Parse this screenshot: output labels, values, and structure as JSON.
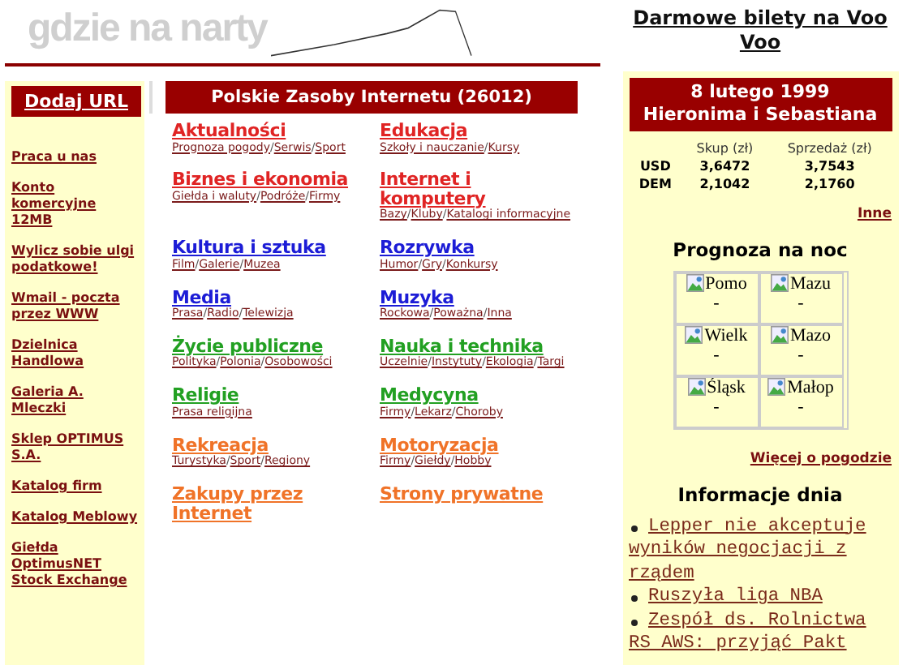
{
  "header": {
    "logo": "gdzie na narty",
    "promo_link": "Darmowe bilety na Voo Voo"
  },
  "sidebar": {
    "button": "Dodaj URL",
    "links": [
      "Praca u nas",
      "Konto komercyjne 12MB",
      "Wylicz sobie ulgi podatkowe!",
      "Wmail - poczta przez WWW",
      "Dzielnica Handlowa",
      "Galeria A. Mleczki",
      "Sklep OPTIMUS S.A.",
      "Katalog firm",
      "Katalog Meblowy",
      "Giełda OptimusNET Stock Exchange"
    ]
  },
  "directory": {
    "title": "Polskie Zasoby Internetu (26012)",
    "categories": [
      {
        "name": "Aktualności",
        "color": "#e02424",
        "links": [
          "Prognoza pogody",
          "Serwis",
          "Sport"
        ]
      },
      {
        "name": "Edukacja",
        "color": "#e02424",
        "links": [
          "Szkoły i nauczanie",
          "Kursy"
        ]
      },
      {
        "name": "Biznes i ekonomia",
        "color": "#e02424",
        "links": [
          "Giełda i waluty",
          "Podróże",
          "Firmy"
        ]
      },
      {
        "name": "Internet i komputery",
        "color": "#e02424",
        "links": [
          "Bazy",
          "Kluby",
          "Katalogi informacyjne"
        ]
      },
      {
        "name": "Kultura i sztuka",
        "color": "#1c1cd6",
        "links": [
          "Film",
          "Galerie",
          "Muzea"
        ]
      },
      {
        "name": "Rozrywka",
        "color": "#1c1cd6",
        "links": [
          "Humor",
          "Gry",
          "Konkursy"
        ]
      },
      {
        "name": "Media",
        "color": "#1c1cd6",
        "links": [
          "Prasa",
          "Radio",
          "Telewizja"
        ]
      },
      {
        "name": "Muzyka",
        "color": "#1c1cd6",
        "links": [
          "Rockowa",
          "Poważna",
          "Inna"
        ]
      },
      {
        "name": "Życie publiczne",
        "color": "#22a022",
        "links": [
          "Polityka",
          "Polonia",
          "Osobowości"
        ]
      },
      {
        "name": "Nauka i technika",
        "color": "#22a022",
        "links": [
          "Uczelnie",
          "Instytuty",
          "Ekologia",
          "Targi"
        ]
      },
      {
        "name": "Religie",
        "color": "#22a022",
        "links": [
          "Prasa religijna"
        ]
      },
      {
        "name": "Medycyna",
        "color": "#22a022",
        "links": [
          "Firmy",
          "Lekarz",
          "Choroby"
        ]
      },
      {
        "name": "Rekreacja",
        "color": "#f07328",
        "links": [
          "Turystyka",
          "Sport",
          "Regiony"
        ]
      },
      {
        "name": "Motoryzacja",
        "color": "#f07328",
        "links": [
          "Firmy",
          "Giełdy",
          "Hobby"
        ]
      },
      {
        "name": "Zakupy przez Internet",
        "color": "#f07328"
      },
      {
        "name": "Strony prywatne",
        "color": "#f07328"
      }
    ],
    "separator": "/"
  },
  "info_panel": {
    "date": "8 lutego 1999",
    "name_day": "Hieronima i Sebastiana",
    "rates": {
      "columns": [
        "Skup (zł)",
        "Sprzedaż (zł)"
      ],
      "rows": [
        {
          "currency": "USD",
          "buy": "3,6472",
          "sell": "3,7543"
        },
        {
          "currency": "DEM",
          "buy": "2,1042",
          "sell": "2,1760"
        }
      ],
      "more_link": "Inne"
    },
    "forecast": {
      "title": "Prognoza na noc",
      "regions": [
        {
          "alt": "Pomo",
          "value": "-"
        },
        {
          "alt": "Mazu",
          "value": "-"
        },
        {
          "alt": "Wielk",
          "value": "-"
        },
        {
          "alt": "Mazo",
          "value": "-"
        },
        {
          "alt": "Śląsk",
          "value": "-"
        },
        {
          "alt": "Małop",
          "value": "-"
        }
      ],
      "more_link": "Więcej o pogodzie"
    },
    "news": {
      "title": "Informacje dnia",
      "items": [
        "Lepper nie akceptuje wyników negocjacji z rządem",
        "Ruszyła liga NBA",
        "Zespół ds. Rolnictwa RS AWS: przyjąć Pakt"
      ]
    }
  }
}
